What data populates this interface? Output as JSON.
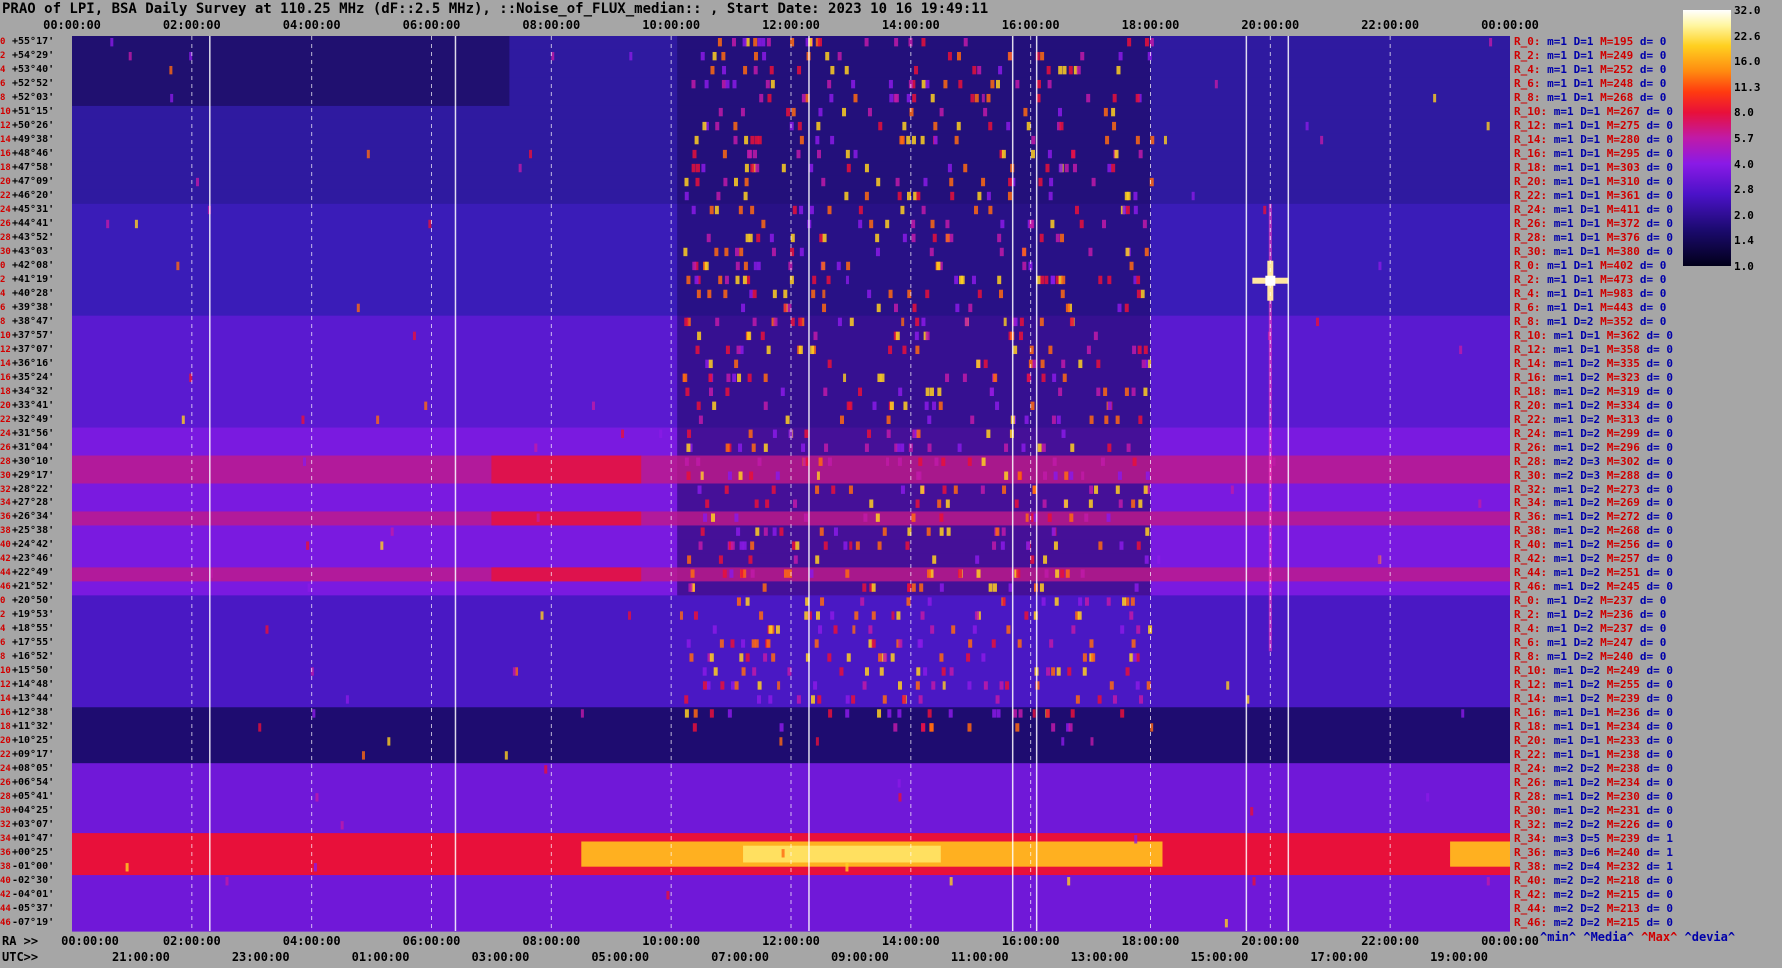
{
  "title": "PRAO of LPI, BSA Daily Survey at 110.25 MHz (dF::2.5 MHz), ::Noise_of_FLUX_median:: , Start Date: 2023 10 16 19:49:11",
  "chart_data": {
    "type": "heatmap",
    "top_axis_ticks": [
      "00:00:00",
      "02:00:00",
      "04:00:00",
      "06:00:00",
      "08:00:00",
      "10:00:00",
      "12:00:00",
      "14:00:00",
      "16:00:00",
      "18:00:00",
      "20:00:00",
      "22:00:00",
      "00:00:00"
    ],
    "ra_axis_prefix": "RA >>",
    "ra_axis_ticks": [
      "00:00:00",
      "02:00:00",
      "04:00:00",
      "06:00:00",
      "08:00:00",
      "10:00:00",
      "12:00:00",
      "14:00:00",
      "16:00:00",
      "18:00:00",
      "20:00:00",
      "22:00:00",
      "00:00:00"
    ],
    "utc_axis_prefix": "UTC>>",
    "utc_axis_ticks": [
      "21:00:00",
      "23:00:00",
      "01:00:00",
      "03:00:00",
      "05:00:00",
      "07:00:00",
      "09:00:00",
      "11:00:00",
      "13:00:00",
      "15:00:00",
      "17:00:00",
      "19:00:00"
    ],
    "declinations": [
      "+55°17'",
      "+54°29'",
      "+53°40'",
      "+52°52'",
      "+52°03'",
      "+51°15'",
      "+50°26'",
      "+49°38'",
      "+48°46'",
      "+47°58'",
      "+47°09'",
      "+46°20'",
      "+45°31'",
      "+44°41'",
      "+43°52'",
      "+43°03'",
      "+42°08'",
      "+41°19'",
      "+40°28'",
      "+39°38'",
      "+38°47'",
      "+37°57'",
      "+37°07'",
      "+36°16'",
      "+35°24'",
      "+34°32'",
      "+33°41'",
      "+32°49'",
      "+31°56'",
      "+31°04'",
      "+30°10'",
      "+29°17'",
      "+28°22'",
      "+27°28'",
      "+26°34'",
      "+25°38'",
      "+24°42'",
      "+23°46'",
      "+22°49'",
      "+21°52'",
      "+20°50'",
      "+19°53'",
      "+18°55'",
      "+17°55'",
      "+16°52'",
      "+15°50'",
      "+14°48'",
      "+13°44'",
      "+12°38'",
      "+11°32'",
      "+10°25'",
      "+09°17'",
      "+08°05'",
      "+06°54'",
      "+05°41'",
      "+04°25'",
      "+03°07'",
      "+01°47'",
      "+00°25'",
      "-01°00'",
      "-02°30'",
      "-04°01'",
      "-05°37'",
      "-07°19'"
    ],
    "row_numbers": [
      "0",
      "2",
      "4",
      "6",
      "8",
      "10",
      "12",
      "14",
      "16",
      "18",
      "20",
      "22",
      "24",
      "26",
      "28",
      "30",
      "0",
      "2",
      "4",
      "6",
      "8",
      "10",
      "12",
      "14",
      "16",
      "18",
      "20",
      "22",
      "24",
      "26",
      "28",
      "30",
      "32",
      "34",
      "36",
      "38",
      "40",
      "42",
      "44",
      "46",
      "0",
      "2",
      "4",
      "6",
      "8",
      "10",
      "12",
      "14",
      "16",
      "18",
      "20",
      "22",
      "24",
      "26",
      "28",
      "30",
      "32",
      "34",
      "36",
      "38",
      "40",
      "42",
      "44",
      "46"
    ],
    "stats": [
      {
        "r": "R_0:",
        "m": "1",
        "D": "1",
        "M": "195",
        "d": "0"
      },
      {
        "r": "R_2:",
        "m": "1",
        "D": "1",
        "M": "249",
        "d": "0"
      },
      {
        "r": "R_4:",
        "m": "1",
        "D": "1",
        "M": "252",
        "d": "0"
      },
      {
        "r": "R_6:",
        "m": "1",
        "D": "1",
        "M": "248",
        "d": "0"
      },
      {
        "r": "R_8:",
        "m": "1",
        "D": "1",
        "M": "268",
        "d": "0"
      },
      {
        "r": "R_10:",
        "m": "1",
        "D": "1",
        "M": "267",
        "d": "0"
      },
      {
        "r": "R_12:",
        "m": "1",
        "D": "1",
        "M": "275",
        "d": "0"
      },
      {
        "r": "R_14:",
        "m": "1",
        "D": "1",
        "M": "280",
        "d": "0"
      },
      {
        "r": "R_16:",
        "m": "1",
        "D": "1",
        "M": "295",
        "d": "0"
      },
      {
        "r": "R_18:",
        "m": "1",
        "D": "1",
        "M": "303",
        "d": "0"
      },
      {
        "r": "R_20:",
        "m": "1",
        "D": "1",
        "M": "310",
        "d": "0"
      },
      {
        "r": "R_22:",
        "m": "1",
        "D": "1",
        "M": "361",
        "d": "0"
      },
      {
        "r": "R_24:",
        "m": "1",
        "D": "1",
        "M": "411",
        "d": "0"
      },
      {
        "r": "R_26:",
        "m": "1",
        "D": "1",
        "M": "372",
        "d": "0"
      },
      {
        "r": "R_28:",
        "m": "1",
        "D": "1",
        "M": "376",
        "d": "0"
      },
      {
        "r": "R_30:",
        "m": "1",
        "D": "1",
        "M": "380",
        "d": "0"
      },
      {
        "r": "R_0:",
        "m": "1",
        "D": "1",
        "M": "402",
        "d": "0"
      },
      {
        "r": "R_2:",
        "m": "1",
        "D": "1",
        "M": "473",
        "d": "0"
      },
      {
        "r": "R_4:",
        "m": "1",
        "D": "1",
        "M": "983",
        "d": "0"
      },
      {
        "r": "R_6:",
        "m": "1",
        "D": "1",
        "M": "443",
        "d": "0"
      },
      {
        "r": "R_8:",
        "m": "1",
        "D": "2",
        "M": "352",
        "d": "0"
      },
      {
        "r": "R_10:",
        "m": "1",
        "D": "1",
        "M": "362",
        "d": "0"
      },
      {
        "r": "R_12:",
        "m": "1",
        "D": "1",
        "M": "358",
        "d": "0"
      },
      {
        "r": "R_14:",
        "m": "1",
        "D": "2",
        "M": "335",
        "d": "0"
      },
      {
        "r": "R_16:",
        "m": "1",
        "D": "2",
        "M": "323",
        "d": "0"
      },
      {
        "r": "R_18:",
        "m": "1",
        "D": "2",
        "M": "319",
        "d": "0"
      },
      {
        "r": "R_20:",
        "m": "1",
        "D": "2",
        "M": "334",
        "d": "0"
      },
      {
        "r": "R_22:",
        "m": "1",
        "D": "2",
        "M": "313",
        "d": "0"
      },
      {
        "r": "R_24:",
        "m": "1",
        "D": "2",
        "M": "299",
        "d": "0"
      },
      {
        "r": "R_26:",
        "m": "1",
        "D": "2",
        "M": "296",
        "d": "0"
      },
      {
        "r": "R_28:",
        "m": "2",
        "D": "3",
        "M": "302",
        "d": "0"
      },
      {
        "r": "R_30:",
        "m": "2",
        "D": "3",
        "M": "288",
        "d": "0"
      },
      {
        "r": "R_32:",
        "m": "1",
        "D": "2",
        "M": "273",
        "d": "0"
      },
      {
        "r": "R_34:",
        "m": "1",
        "D": "2",
        "M": "269",
        "d": "0"
      },
      {
        "r": "R_36:",
        "m": "1",
        "D": "2",
        "M": "272",
        "d": "0"
      },
      {
        "r": "R_38:",
        "m": "1",
        "D": "2",
        "M": "268",
        "d": "0"
      },
      {
        "r": "R_40:",
        "m": "1",
        "D": "2",
        "M": "256",
        "d": "0"
      },
      {
        "r": "R_42:",
        "m": "1",
        "D": "2",
        "M": "257",
        "d": "0"
      },
      {
        "r": "R_44:",
        "m": "1",
        "D": "2",
        "M": "251",
        "d": "0"
      },
      {
        "r": "R_46:",
        "m": "1",
        "D": "2",
        "M": "245",
        "d": "0"
      },
      {
        "r": "R_0:",
        "m": "1",
        "D": "2",
        "M": "237",
        "d": "0"
      },
      {
        "r": "R_2:",
        "m": "1",
        "D": "2",
        "M": "236",
        "d": "0"
      },
      {
        "r": "R_4:",
        "m": "1",
        "D": "2",
        "M": "237",
        "d": "0"
      },
      {
        "r": "R_6:",
        "m": "1",
        "D": "2",
        "M": "247",
        "d": "0"
      },
      {
        "r": "R_8:",
        "m": "1",
        "D": "2",
        "M": "240",
        "d": "0"
      },
      {
        "r": "R_10:",
        "m": "1",
        "D": "2",
        "M": "249",
        "d": "0"
      },
      {
        "r": "R_12:",
        "m": "1",
        "D": "2",
        "M": "255",
        "d": "0"
      },
      {
        "r": "R_14:",
        "m": "1",
        "D": "2",
        "M": "239",
        "d": "0"
      },
      {
        "r": "R_16:",
        "m": "1",
        "D": "1",
        "M": "236",
        "d": "0"
      },
      {
        "r": "R_18:",
        "m": "1",
        "D": "1",
        "M": "234",
        "d": "0"
      },
      {
        "r": "R_20:",
        "m": "1",
        "D": "1",
        "M": "233",
        "d": "0"
      },
      {
        "r": "R_22:",
        "m": "1",
        "D": "1",
        "M": "238",
        "d": "0"
      },
      {
        "r": "R_24:",
        "m": "2",
        "D": "2",
        "M": "238",
        "d": "0"
      },
      {
        "r": "R_26:",
        "m": "1",
        "D": "2",
        "M": "234",
        "d": "0"
      },
      {
        "r": "R_28:",
        "m": "1",
        "D": "2",
        "M": "230",
        "d": "0"
      },
      {
        "r": "R_30:",
        "m": "1",
        "D": "2",
        "M": "231",
        "d": "0"
      },
      {
        "r": "R_32:",
        "m": "2",
        "D": "2",
        "M": "226",
        "d": "0"
      },
      {
        "r": "R_34:",
        "m": "3",
        "D": "5",
        "M": "239",
        "d": "1"
      },
      {
        "r": "R_36:",
        "m": "3",
        "D": "6",
        "M": "240",
        "d": "1"
      },
      {
        "r": "R_38:",
        "m": "2",
        "D": "4",
        "M": "232",
        "d": "1"
      },
      {
        "r": "R_40:",
        "m": "2",
        "D": "2",
        "M": "218",
        "d": "0"
      },
      {
        "r": "R_42:",
        "m": "2",
        "D": "2",
        "M": "215",
        "d": "0"
      },
      {
        "r": "R_44:",
        "m": "2",
        "D": "2",
        "M": "213",
        "d": "0"
      },
      {
        "r": "R_46:",
        "m": "2",
        "D": "2",
        "M": "215",
        "d": "0"
      }
    ],
    "colorbar_ticks": [
      "32.0",
      "22.6",
      "16.0",
      "11.3",
      "8.0",
      "5.7",
      "4.0",
      "2.8",
      "2.0",
      "1.4",
      "1.0"
    ],
    "colorbar_colors": [
      "#02001a",
      "#1b0a6e",
      "#4b12c8",
      "#8a1ae6",
      "#c01aa8",
      "#e8103a",
      "#ff3a10",
      "#ff8a10",
      "#ffd020",
      "#fff6a0",
      "#ffffff"
    ],
    "x_range_hours": [
      0,
      24
    ],
    "bright_bands": [
      {
        "dec_from": "+01°47'",
        "dec_to": "-01°00'",
        "level": "high"
      },
      {
        "dec_from": "+30°10'",
        "dec_to": "+29°17'",
        "level": "medium"
      },
      {
        "dec_from": "+26°34'",
        "dec_to": "+26°34'",
        "level": "medium"
      },
      {
        "dec_from": "+22°49'",
        "dec_to": "+22°49'",
        "level": "medium"
      }
    ],
    "bright_source": {
      "ra_hours": 20.0,
      "dec": "+41°19'",
      "level": "max"
    }
  },
  "legend": {
    "min": "^min^",
    "median": "^Media^",
    "max": "^Max^",
    "dev": "^devia^"
  }
}
